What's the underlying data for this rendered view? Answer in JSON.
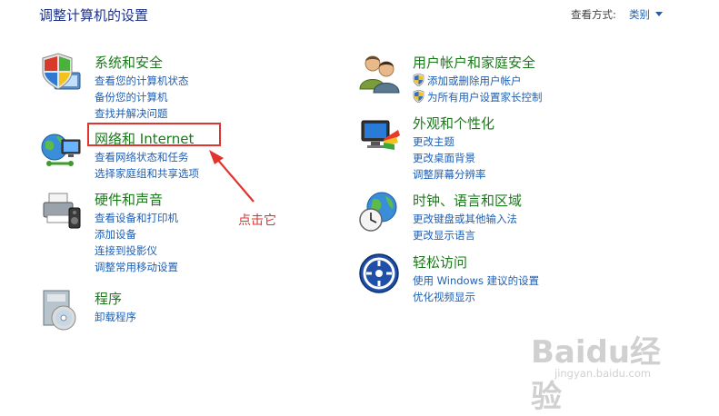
{
  "page": {
    "title": "调整计算机的设置",
    "view_by_label": "查看方式:",
    "view_by_value": "类别"
  },
  "categories": {
    "system": {
      "heading": "系统和安全",
      "icon": "shield-computer-icon",
      "links": [
        "查看您的计算机状态",
        "备份您的计算机",
        "查找并解决问题"
      ]
    },
    "network": {
      "heading": "网络和 Internet",
      "icon": "network-globe-icon",
      "links": [
        "查看网络状态和任务",
        "选择家庭组和共享选项"
      ]
    },
    "hardware": {
      "heading": "硬件和声音",
      "icon": "printer-speaker-icon",
      "links": [
        "查看设备和打印机",
        "添加设备",
        "连接到投影仪",
        "调整常用移动设置"
      ]
    },
    "programs": {
      "heading": "程序",
      "icon": "programs-disc-icon",
      "links": [
        "卸载程序"
      ]
    },
    "users": {
      "heading": "用户帐户和家庭安全",
      "icon": "users-icon",
      "links": [
        "添加或删除用户帐户",
        "为所有用户设置家长控制"
      ]
    },
    "appearance": {
      "heading": "外观和个性化",
      "icon": "monitor-palette-icon",
      "links": [
        "更改主题",
        "更改桌面背景",
        "调整屏幕分辨率"
      ]
    },
    "clock": {
      "heading": "时钟、语言和区域",
      "icon": "globe-clock-icon",
      "links": [
        "更改键盘或其他输入法",
        "更改显示语言"
      ]
    },
    "ease": {
      "heading": "轻松访问",
      "icon": "ease-of-access-icon",
      "links": [
        "使用 Windows 建议的设置",
        "优化视频显示"
      ]
    }
  },
  "annotation": {
    "text": "点击它",
    "color": "#e0342e"
  },
  "watermark": {
    "line1": "Baidu经验",
    "line2": "jingyan.baidu.com"
  },
  "colors": {
    "heading": "#1a7a1a",
    "link": "#1e5fb4",
    "title": "#1e3287"
  }
}
